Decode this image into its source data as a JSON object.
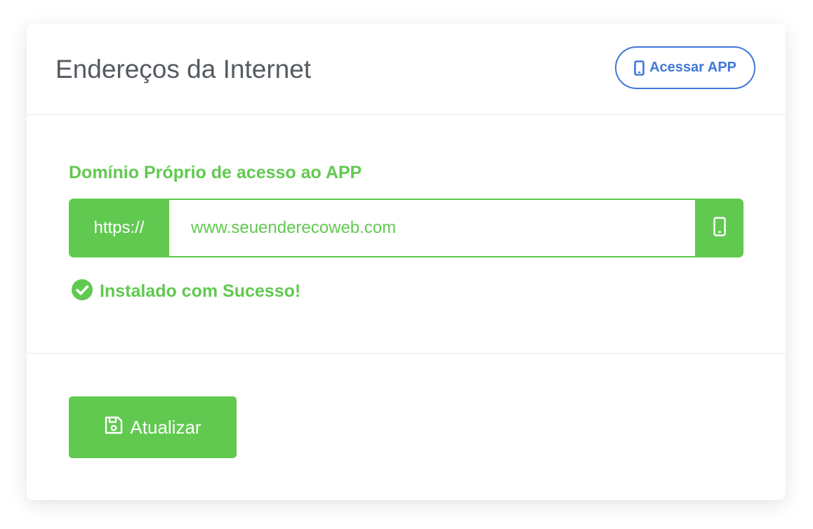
{
  "header": {
    "title": "Endereços da Internet",
    "app_button_label": "Acessar APP",
    "app_button_icon": "mobile-phone-icon"
  },
  "domain_field": {
    "label": "Domínio Próprio de acesso ao APP",
    "prefix": "https://",
    "value": "www.seuenderecoweb.com",
    "suffix_icon": "mobile-phone-icon"
  },
  "status": {
    "icon": "check-circle-icon",
    "text": "Instalado com Sucesso!"
  },
  "footer": {
    "save_label": "Atualizar",
    "save_icon": "floppy-disk-icon"
  },
  "colors": {
    "accent_green": "#61c950",
    "accent_blue": "#3f78d8",
    "title_text": "#555a61",
    "divider": "#e7e8ea"
  }
}
